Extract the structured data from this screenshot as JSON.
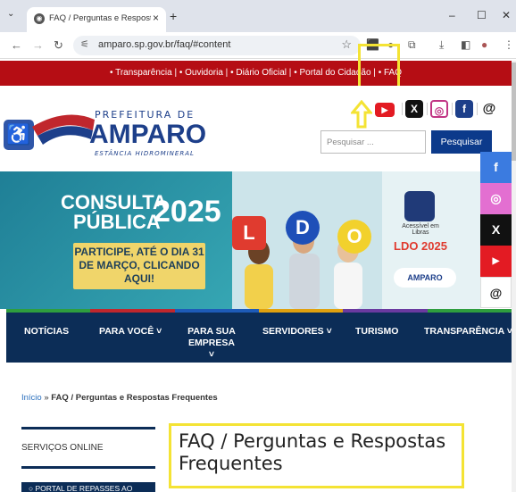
{
  "browser": {
    "tab_title": "FAQ / Perguntas e Respostas Fr",
    "url": "amparo.sp.gov.br/faq/#content",
    "window_controls": [
      "–",
      "☐",
      "✕"
    ]
  },
  "topbar": {
    "links": [
      "• Transparência",
      "• Ouvidoria",
      "• Diário Oficial",
      "• Portal do Cidadão",
      "• FAQ"
    ],
    "color": "#b50d14"
  },
  "header": {
    "logo_line1": "PREFEITURA DE",
    "logo_line2": "AMPARO",
    "logo_line3": "ESTÂNCIA HIDROMINERAL",
    "search_placeholder": "Pesquisar ...",
    "search_button": "Pesquisar",
    "social_icons": [
      "youtube-icon",
      "x-icon",
      "instagram-icon",
      "facebook-icon",
      "threads-icon"
    ]
  },
  "banner": {
    "title_line1": "CONSULTA",
    "title_line2": "PÚBLICA",
    "year": "2025",
    "cta": "PARTICIPE, ATÉ O DIA 31 DE MARÇO, CLICANDO AQUI!",
    "ldo_letters": [
      "L",
      "D",
      "O"
    ],
    "libras_text": "Acessível em Libras",
    "ldo_small": "LDO 2025",
    "amparo_badge": "AMPARO"
  },
  "floating_social": [
    "f",
    "◎",
    "X",
    "▶",
    "@"
  ],
  "nav": {
    "items": [
      "NOTÍCIAS",
      "PARA VOCÊ ˅",
      "PARA SUA EMPRESA ˅",
      "SERVIDORES ˅",
      "TURISMO",
      "TRANSPARÊNCIA ˅"
    ],
    "colors": [
      "#2e9e3e",
      "#c0272d",
      "#1e5bb8",
      "#e0a10f",
      "#6a3aa0",
      "#2e9e3e"
    ]
  },
  "breadcrumb": {
    "home": "Início",
    "separator": " » ",
    "current": "FAQ / Perguntas e Respostas Frequentes"
  },
  "sidebar": {
    "title": "SERVIÇOS ONLINE",
    "item": "○ PORTAL DE REPASSES AO"
  },
  "main": {
    "title": "FAQ / Perguntas e Respostas Frequentes"
  },
  "highlight_color": "#f4e334"
}
